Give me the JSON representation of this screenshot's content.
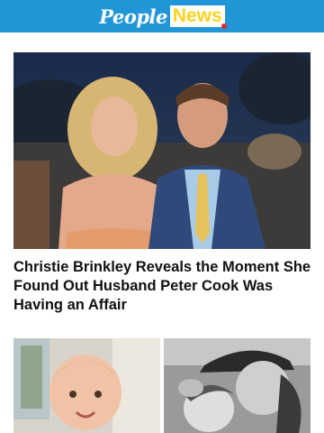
{
  "header": {
    "logo_people": "People",
    "logo_news": "News",
    "brand_color": "#2196d6",
    "accent_color": "#ffd11a"
  },
  "hero": {
    "image_icon": "photo-couple-icon",
    "headline": "Christie Brinkley Reveals the Moment She Found Out Husband Peter Cook Was Having an Affair"
  },
  "thumbnails": [
    {
      "icon": "photo-baby-icon"
    },
    {
      "icon": "photo-mother-child-icon"
    }
  ]
}
